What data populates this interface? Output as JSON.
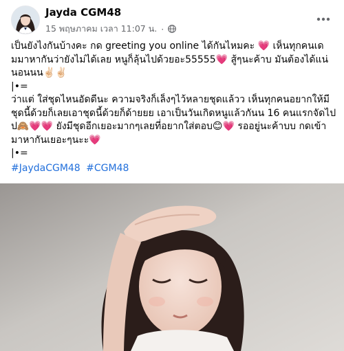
{
  "post": {
    "author": "Jayda CGM48",
    "timestamp": "15 พฤษภาคม เวลา 11:07 น.",
    "audience_icon": "globe-icon",
    "more_icon": "more-horizontal-icon",
    "lines": [
      "เป็นยังไงกันบ้างคะ กด greeting you online ได้กันไหมคะ 💗 เห็นทุกคนเด",
      "มมาหากันว่ายังไม่ได้เลย หนูก็ลุ้นไปด้วยอะ55555💗 สู้ๆนะค้าบ มันต้องได้แน่",
      "นอนนน✌🏻✌🏻",
      "|•=",
      "ว่าแต่ ใส่ชุดไหนอัดดีนะ ความจริงก็เล็งๆไว้หลายชุดแล้วว เห็นทุกคนอยากให้มี",
      "ชุดนี้ด้วยก็เลยเอาชุดนี้ด้วยก็ด้ายยย เอาเป็นวันเกิดหนูแล้วกันน 16 คนแรกจัดไป",
      "ป🙈💗💗 ยังมีชุดอีกเยอะมากๆเลยที่อยากใส่ตอบ😊💗 รออยู่นะค้าบบ กดเข้า",
      "มาหากันเยอะๆนะะ💗",
      "|•="
    ],
    "hashtags": [
      "#JaydaCGM48",
      "#CGM48"
    ],
    "colors": {
      "link": "#216fdb",
      "secondary_text": "#65676b",
      "heart": "#f02849"
    }
  }
}
